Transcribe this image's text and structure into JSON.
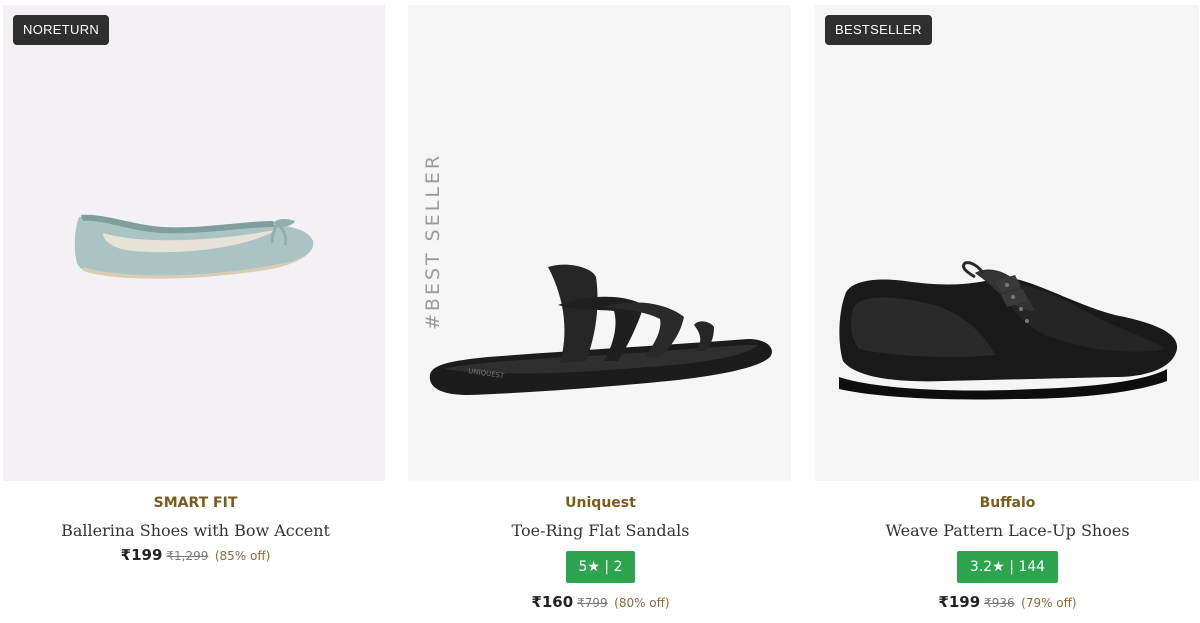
{
  "products": [
    {
      "badge": "NORETURN",
      "brand": "SMART FIT",
      "name": "Ballerina Shoes with Bow Accent",
      "price": "₹199",
      "mrp": "₹1,299",
      "discount": "(85% off)",
      "image_icon": "ballerina-shoe-icon"
    },
    {
      "overlay_text": "#BEST SELLER",
      "brand": "Uniquest",
      "name": "Toe-Ring Flat Sandals",
      "rating": "5★ | 2",
      "price": "₹160",
      "mrp": "₹799",
      "discount": "(80% off)",
      "sole_print": "UNIQUEST",
      "image_icon": "toe-ring-sandal-icon"
    },
    {
      "badge": "BESTSELLER",
      "brand": "Buffalo",
      "name": "Weave Pattern Lace-Up Shoes",
      "rating": "3.2★ | 144",
      "price": "₹199",
      "mrp": "₹936",
      "discount": "(79% off)",
      "image_icon": "lace-up-shoe-icon"
    }
  ],
  "colors": {
    "brand_text": "#7a5c1e",
    "rating_bg": "#2ea44f",
    "badge_bg": "#2f2f2f"
  }
}
